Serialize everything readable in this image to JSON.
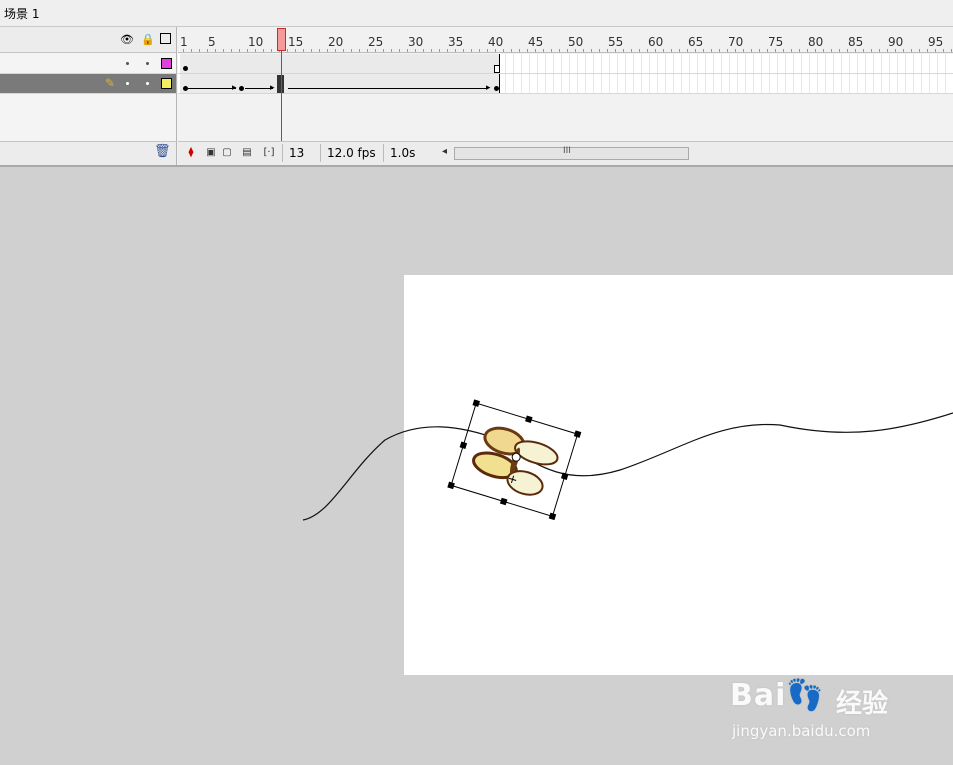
{
  "scene": {
    "label": "场景 1"
  },
  "timeline": {
    "ruler_labels": [
      "1",
      "5",
      "10",
      "15",
      "20",
      "25",
      "30",
      "35",
      "40",
      "45",
      "50",
      "55",
      "60",
      "65",
      "70",
      "75",
      "80",
      "85",
      "90",
      "95"
    ],
    "current_frame": "13",
    "frame_rate": "12.0 fps",
    "elapsed_time": "1.0s",
    "layer_colors": {
      "layer1": "#e040e0",
      "layer2": "#f0f060"
    },
    "playhead_color": "#f59a9a",
    "icons": {
      "eye": "eye-icon",
      "lock": "lock-icon",
      "outline": "outline-icon",
      "pencil": "pencil-icon",
      "trash": "trash-icon"
    },
    "scroll_grip": "III"
  },
  "watermark": {
    "logo": "Bai👣",
    "jingyan": "经验",
    "url": "jingyan.baidu.com"
  }
}
